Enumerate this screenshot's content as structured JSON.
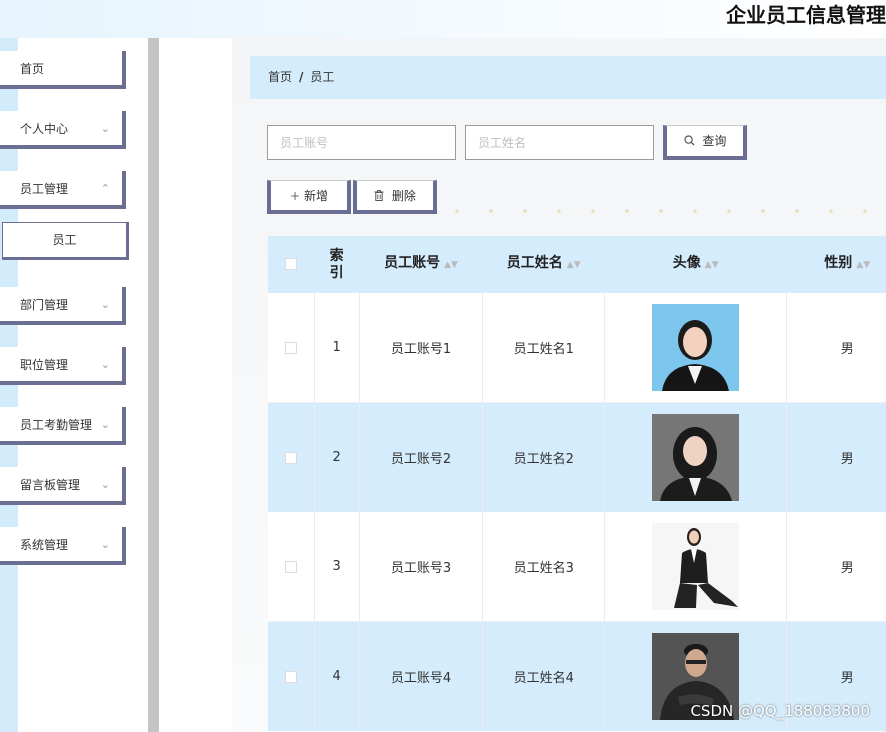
{
  "header": {
    "title": "企业员工信息管理"
  },
  "sidebar": {
    "items": [
      {
        "label": "首页",
        "chevron": false
      },
      {
        "label": "个人中心",
        "chevron": true
      },
      {
        "label": "员工管理",
        "chevron": true
      },
      {
        "label": "员工",
        "sub": true
      },
      {
        "label": "部门管理",
        "chevron": true
      },
      {
        "label": "职位管理",
        "chevron": true
      },
      {
        "label": "员工考勤管理",
        "chevron": true
      },
      {
        "label": "留言板管理",
        "chevron": true
      },
      {
        "label": "系统管理",
        "chevron": true
      }
    ]
  },
  "breadcrumb": {
    "home": "首页",
    "separator": "/",
    "current": "员工"
  },
  "search": {
    "account_placeholder": "员工账号",
    "name_placeholder": "员工姓名",
    "query_label": "查询",
    "query_icon": "search-icon"
  },
  "toolbar": {
    "add_label": "新增",
    "add_icon": "plus-icon",
    "delete_label": "删除",
    "delete_icon": "trash-icon"
  },
  "table": {
    "headers": {
      "index_line1": "索",
      "index_line2": "引",
      "account": "员工账号",
      "name": "员工姓名",
      "avatar": "头像",
      "gender": "性别"
    },
    "rows": [
      {
        "index": "1",
        "account": "员工账号1",
        "name": "员工姓名1",
        "gender": "男"
      },
      {
        "index": "2",
        "account": "员工账号2",
        "name": "员工姓名2",
        "gender": "男"
      },
      {
        "index": "3",
        "account": "员工账号3",
        "name": "员工姓名3",
        "gender": "男"
      },
      {
        "index": "4",
        "account": "员工账号4",
        "name": "员工姓名4",
        "gender": "男"
      }
    ]
  },
  "watermark": "CSDN @QQ_188083800",
  "colors": {
    "accent_border": "#6b6e93",
    "light_blue": "#d4ecfb",
    "divider_gray": "#c4c4c4"
  }
}
